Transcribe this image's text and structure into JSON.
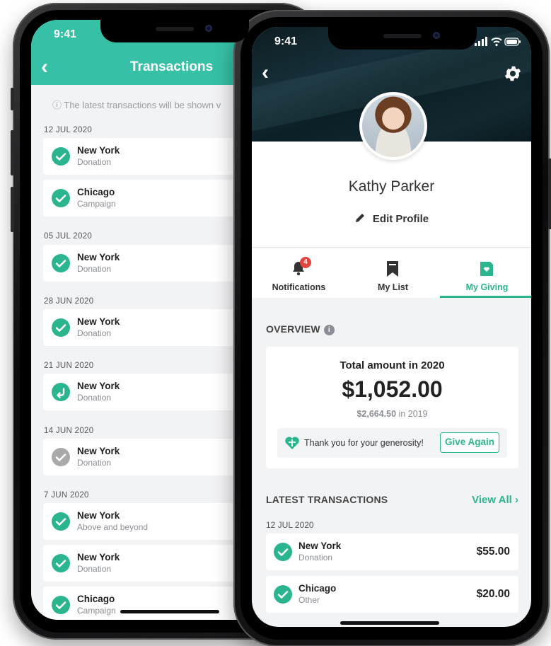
{
  "left_phone": {
    "status_time": "9:41",
    "header_title": "Transactions",
    "info_text": "ⓘ The latest transactions will be shown v",
    "groups": [
      {
        "date": "12 JUL 2020",
        "items": [
          {
            "name": "New York",
            "type": "Donation",
            "status": "completed"
          },
          {
            "name": "Chicago",
            "type": "Campaign",
            "status": "completed"
          }
        ]
      },
      {
        "date": "05 JUL 2020",
        "items": [
          {
            "name": "New York",
            "type": "Donation",
            "status": "completed"
          }
        ]
      },
      {
        "date": "28 JUN 2020",
        "items": [
          {
            "name": "New York",
            "type": "Donation",
            "status": "completed"
          }
        ]
      },
      {
        "date": "21 JUN 2020",
        "items": [
          {
            "name": "New York",
            "type": "Donation",
            "status": "refunded"
          }
        ]
      },
      {
        "date": "14 JUN 2020",
        "items": [
          {
            "name": "New York",
            "type": "Donation",
            "status": "pending"
          }
        ]
      },
      {
        "date": "7 JUN 2020",
        "items": [
          {
            "name": "New York",
            "type": "Above and beyond",
            "status": "completed"
          },
          {
            "name": "New York",
            "type": "Donation",
            "status": "completed"
          },
          {
            "name": "Chicago",
            "type": "Campaign",
            "status": "completed"
          }
        ]
      }
    ]
  },
  "right_phone": {
    "status_time": "9:41",
    "profile": {
      "name": "Kathy Parker",
      "edit_label": "Edit Profile"
    },
    "tabs": [
      {
        "label": "Notifications",
        "icon": "bell-icon",
        "badge": "4",
        "active": false
      },
      {
        "label": "My List",
        "icon": "bookmark-icon",
        "active": false
      },
      {
        "label": "My Giving",
        "icon": "giving-icon",
        "active": true
      }
    ],
    "overview": {
      "title": "OVERVIEW",
      "info": "i",
      "label": "Total amount in 2020",
      "amount": "$1,052.00",
      "prev_amount": "$2,664.50",
      "prev_suffix": " in 2019",
      "thanks_text": "Thank you for your generosity!",
      "give_again": "Give Again"
    },
    "latest": {
      "title": "LATEST TRANSACTIONS",
      "view_all": "View All",
      "view_all_chevron": "›",
      "date": "12 JUL 2020",
      "items": [
        {
          "name": "New York",
          "type": "Donation",
          "amount": "$55.00"
        },
        {
          "name": "Chicago",
          "type": "Other",
          "amount": "$20.00"
        }
      ]
    }
  },
  "colors": {
    "accent": "#36c0a5",
    "success": "#2bb58f",
    "badge": "#e0463f",
    "pending": "#a9a9a9"
  }
}
